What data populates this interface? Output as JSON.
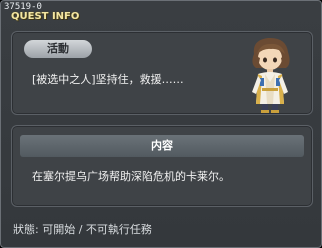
{
  "quest_id": "37519-0",
  "window_title": "QUEST INFO",
  "category_tag": "活動",
  "quest_name": "[被选中之人]坚持住，救援……",
  "portrait_icon": "npc-portrait-icon",
  "section": {
    "header": "内容",
    "text": "在塞尔提乌广场帮助深陷危机的卡莱尔。"
  },
  "status_text": "狀態: 可開始 / 不可執行任務",
  "colors": {
    "title": "#f3e6a3",
    "panel": "#3f4347",
    "window": "#383c40"
  }
}
